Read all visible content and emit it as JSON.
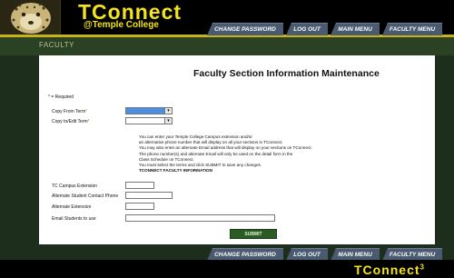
{
  "header": {
    "title": "TConnect",
    "subtitle": "@Temple College"
  },
  "nav": {
    "tabs": [
      "Change Password",
      "Log Out",
      "Main Menu",
      "Faculty Menu"
    ]
  },
  "section": {
    "label": "Faculty"
  },
  "page": {
    "heading": "Faculty Section Information Maintenance",
    "required_note": "* = Required"
  },
  "form": {
    "copy_from_term": {
      "label": "Copy From Term",
      "marker": "*"
    },
    "copy_edit_term": {
      "label": "Copy to/Edit Term",
      "marker": "*"
    },
    "info_lines": [
      "You can enter your Temple College Campus extension and/or",
      "an alternative phone number that will display on all your sections in TConnect.",
      "You may also enter an alternate Email address that will display on your sections on TConnect.",
      "The phone number(s) and alternate Email will only be used on the detail form in the",
      "Class Schedule on TConnect.",
      "You must select the terms and click SUBMIT to save any changes."
    ],
    "info_heading": "TCONNECT FACULTY INFORMATION",
    "campus_extension_label": "TC Campus Extension",
    "alt_phone_label": "Alternate Student Contact Phone",
    "alt_extension_label": "Alternate Extension",
    "email_label": "Email Students to use",
    "submit_label": "SUBMIT"
  },
  "footer": {
    "brand": "TConnect",
    "brand_sup": "3"
  }
}
